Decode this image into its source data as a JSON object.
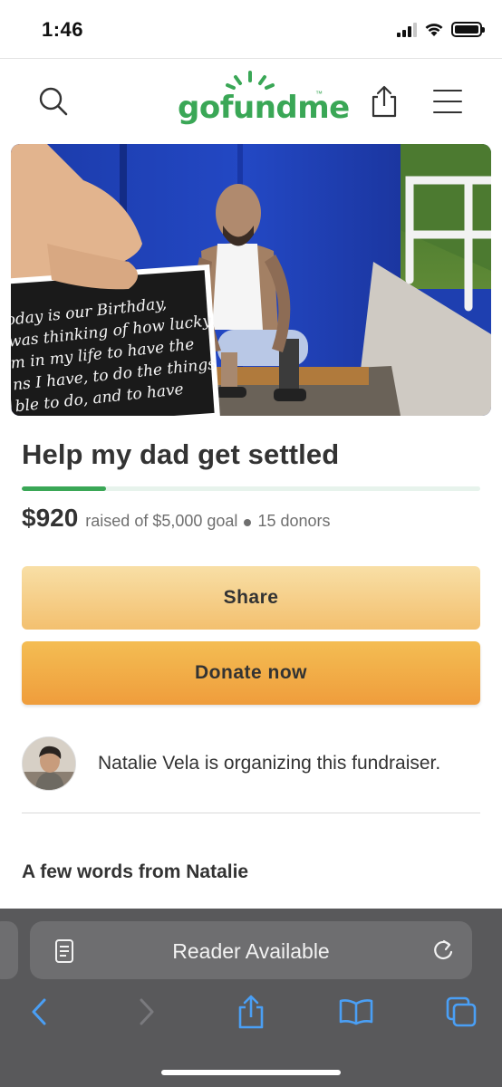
{
  "status_bar": {
    "time": "1:46",
    "icons": [
      "cellular-signal-icon",
      "wifi-icon",
      "battery-icon"
    ]
  },
  "header": {
    "logo_text": "gofundme",
    "logo_tm": "™",
    "icons": [
      "search-icon",
      "share-icon",
      "menu-icon"
    ]
  },
  "campaign": {
    "title": "Help my dad get settled",
    "amount_raised": "$920",
    "raised_text": "raised of $5,000 goal",
    "donor_count": "15 donors",
    "progress_fraction": 0.184
  },
  "hero_card_text": [
    "oday is our Birthday,",
    "was thinking of how lucky",
    "m in my life to have the",
    "ns I have, to do the things",
    "ble to do, and to have"
  ],
  "buttons": {
    "share_label": "Share",
    "donate_label": "Donate now"
  },
  "organizer": {
    "text": "Natalie Vela is organizing this fundraiser."
  },
  "story": {
    "heading": "A few words from Natalie"
  },
  "browser": {
    "address_text": "Reader Available",
    "icons": [
      "reader-icon",
      "reload-icon",
      "back-icon",
      "forward-icon",
      "share-icon",
      "bookmarks-icon",
      "tabs-icon"
    ]
  },
  "colors": {
    "brand_green": "#3aa756",
    "share_button": "#f6d08c",
    "donate_button": "#f2ad48",
    "toolbar_bg": "#59595b",
    "toolbar_accent": "#4a9ff5"
  }
}
